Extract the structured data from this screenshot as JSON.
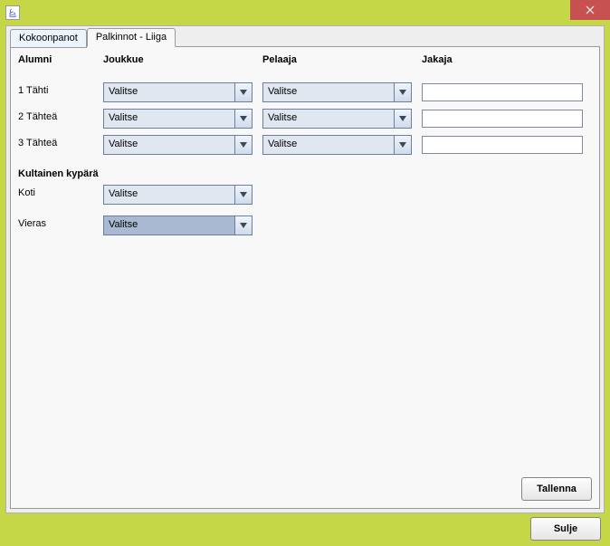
{
  "tabs": {
    "kokoonpanot": "Kokoonpanot",
    "palkinnot": "Palkinnot - Liiga"
  },
  "headers": {
    "alumni": "Alumni",
    "joukkue": "Joukkue",
    "pelaaja": "Pelaaja",
    "jakaja": "Jakaja"
  },
  "rows": {
    "t1": "1 Tähti",
    "t2": "2 Tähteä",
    "t3": "3 Tähteä"
  },
  "section2": {
    "title": "Kultainen kypärä",
    "koti": "Koti",
    "vieras": "Vieras"
  },
  "combos": {
    "team1": "Valitse",
    "team2": "Valitse",
    "team3": "Valitse",
    "player1": "Valitse",
    "player2": "Valitse",
    "player3": "Valitse",
    "home": "Valitse",
    "away": "Valitse"
  },
  "inputs": {
    "dist1": "",
    "dist2": "",
    "dist3": ""
  },
  "buttons": {
    "save": "Tallenna",
    "close": "Sulje"
  }
}
